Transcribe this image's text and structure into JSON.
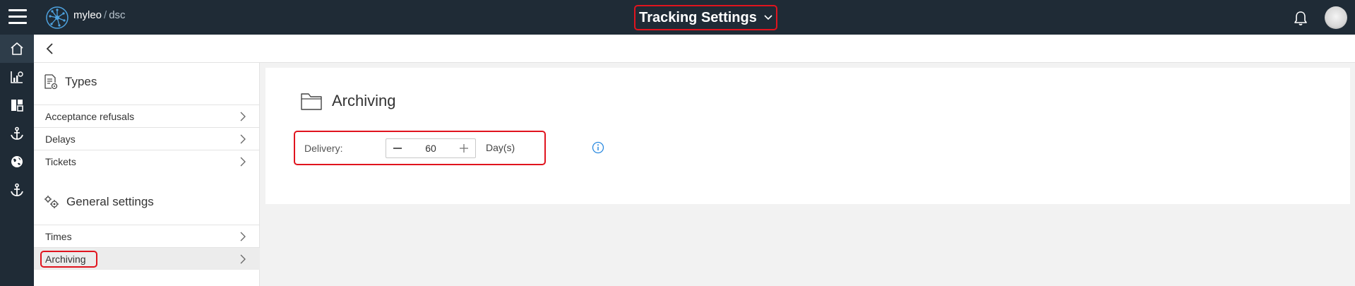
{
  "header": {
    "brand": "myleo",
    "brand_separator": "/",
    "brand_sub": "dsc",
    "title": "Tracking Settings"
  },
  "rail": {
    "icons": [
      "home-icon",
      "analytics-icon",
      "dashboard-icon",
      "anchor-icon",
      "globe-icon",
      "anchor-icon"
    ]
  },
  "sidenav": {
    "types_heading": "Types",
    "types_items": [
      {
        "label": "Acceptance refusals"
      },
      {
        "label": "Delays"
      },
      {
        "label": "Tickets"
      }
    ],
    "general_heading": "General settings",
    "general_items": [
      {
        "label": "Times"
      },
      {
        "label": "Archiving"
      }
    ]
  },
  "content": {
    "title": "Archiving",
    "delivery_label": "Delivery:",
    "delivery_value": "60",
    "delivery_unit": "Day(s)"
  },
  "colors": {
    "topbar": "#1f2b36",
    "highlight": "#e0141e",
    "info": "#2b8ae0",
    "logo_accent": "#4ea3e0"
  }
}
